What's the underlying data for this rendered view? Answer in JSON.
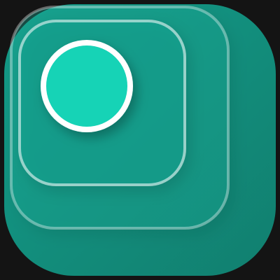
{
  "icon": {
    "name": "app-icon",
    "shape": "squircle",
    "colors": {
      "background": "#141414",
      "tile_light": "#139c89",
      "tile_dark": "#117f6f",
      "inner_square_1": "#17b09a",
      "inner_square_2": "#13a491",
      "frame_stroke": "#ffffff",
      "ring": "#ffffff",
      "dot": "#13d3b6"
    }
  }
}
